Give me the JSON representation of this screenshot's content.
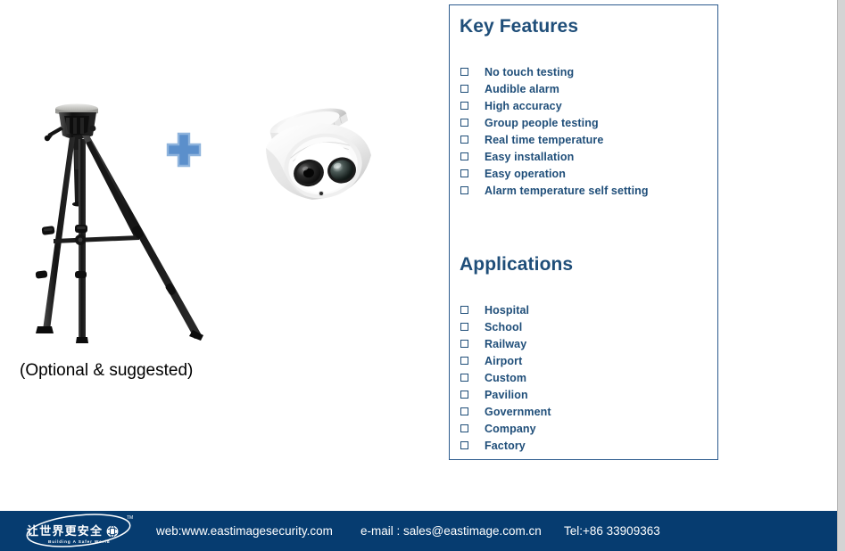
{
  "page": {
    "background_color": "#ffffff",
    "accent_blue": "#1f4e79",
    "border_blue": "#2d5b8e",
    "plus_blue": "#5b8fcb",
    "footer_navy": "#063C70"
  },
  "product": {
    "tripod_caption": "(Optional & suggested)",
    "tripod_icon": "camera-tripod",
    "plus_icon": "plus-sign",
    "camera_icon": "dome-cctv-camera"
  },
  "panel": {
    "key_features": {
      "heading": "Key Features",
      "items": [
        "No touch testing",
        "Audible alarm",
        "High accuracy",
        "Group people testing",
        "Real time temperature",
        "Easy installation",
        "Easy operation",
        "Alarm temperature self setting"
      ]
    },
    "applications": {
      "heading": "Applications",
      "items": [
        "Hospital",
        "School",
        "Railway",
        "Airport",
        "Custom",
        "Pavilion",
        "Government",
        "Company",
        "Factory"
      ]
    }
  },
  "footer": {
    "logo": {
      "chinese_slogan": "让世界更安全",
      "english_slogan": "Building A Safer World",
      "trademark": "TM",
      "icon": "globe-swoosh-logo"
    },
    "web": "web:www.eastimagesecurity.com",
    "email": "e-mail : sales@eastimage.com.cn",
    "tel": "Tel:+86 33909363"
  }
}
